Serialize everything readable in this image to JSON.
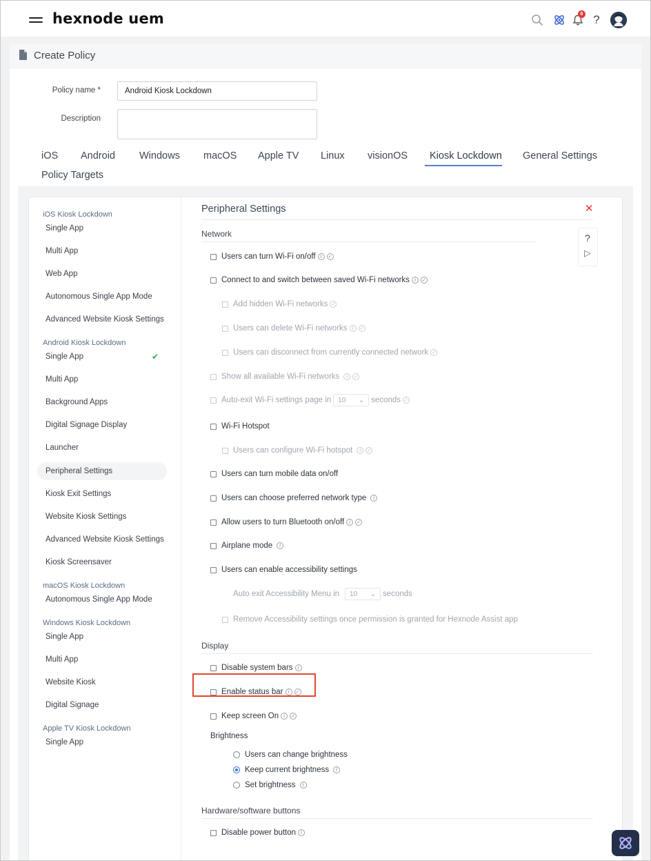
{
  "header": {
    "logo": "hexnode uem",
    "notification_count": "6",
    "help_label": "?"
  },
  "page": {
    "title": "Create Policy"
  },
  "form": {
    "policy_name_label": "Policy name *",
    "policy_name_value": "Android Kiosk Lockdown",
    "description_label": "Description",
    "description_value": ""
  },
  "tabs": [
    {
      "label": "iOS"
    },
    {
      "label": "Android"
    },
    {
      "label": "Windows"
    },
    {
      "label": "macOS"
    },
    {
      "label": "Apple TV"
    },
    {
      "label": "Linux"
    },
    {
      "label": "visionOS"
    },
    {
      "label": "Kiosk Lockdown",
      "active": true
    },
    {
      "label": "General Settings"
    },
    {
      "label": "Policy Targets"
    }
  ],
  "sidebar": {
    "groups": [
      {
        "title": "iOS Kiosk Lockdown",
        "items": [
          "Single App",
          "Multi App",
          "Web App",
          "Autonomous Single App Mode",
          "Advanced Website Kiosk Settings"
        ]
      },
      {
        "title": "Android Kiosk Lockdown",
        "items": [
          "Single App",
          "Multi App",
          "Background Apps",
          "Digital Signage Display",
          "Launcher",
          "Peripheral Settings",
          "Kiosk Exit Settings",
          "Website Kiosk Settings",
          "Advanced Website Kiosk Settings",
          "Kiosk Screensaver"
        ]
      },
      {
        "title": "macOS Kiosk Lockdown",
        "items": [
          "Autonomous Single App Mode"
        ]
      },
      {
        "title": "Windows Kiosk Lockdown",
        "items": [
          "Single App",
          "Multi App",
          "Website Kiosk",
          "Digital Signage"
        ]
      },
      {
        "title": "Apple TV Kiosk Lockdown",
        "items": [
          "Single App"
        ]
      }
    ],
    "selected": "Peripheral Settings",
    "configured": "Single App"
  },
  "section": {
    "title": "Peripheral Settings",
    "close_label": "✕",
    "help_label": "?",
    "play_label": "▷"
  },
  "network": {
    "heading": "Network",
    "options": {
      "wifi_onoff": "Users can turn Wi-Fi on/off",
      "switch_saved": "Connect to and switch between saved Wi-Fi networks",
      "add_hidden": "Add hidden Wi-Fi networks",
      "delete_wifi": "Users can delete Wi-Fi networks",
      "disconnect": "Users can disconnect from currently connected network",
      "show_all": "Show all available Wi-Fi networks",
      "auto_exit_prefix": "Auto-exit Wi-Fi settings page in",
      "auto_exit_value": "10",
      "auto_exit_suffix": "seconds",
      "hotspot": "Wi-Fi Hotspot",
      "config_hotspot": "Users can configure Wi-Fi hotspot",
      "mobile_data": "Users can turn mobile data on/off",
      "network_type": "Users can choose preferred network type",
      "bluetooth": "Allow users to turn Bluetooth on/off",
      "airplane": "Airplane mode",
      "accessibility": "Users can enable accessibility settings",
      "acc_exit_prefix": "Auto exit Accessibility Menu in",
      "acc_exit_value": "10",
      "acc_exit_suffix": "seconds",
      "remove_acc": "Remove Accessibility settings once permission is granted for Hexnode Assist app"
    }
  },
  "display": {
    "heading": "Display",
    "disable_bars": "Disable system bars",
    "status_bar": "Enable status bar",
    "keep_screen": "Keep screen On",
    "brightness_label": "Brightness",
    "brightness_options": [
      "Users can change brightness",
      "Keep current brightness",
      "Set brightness"
    ],
    "brightness_selected": "Keep current brightness"
  },
  "hardware": {
    "heading": "Hardware/software buttons",
    "power_button": "Disable power button"
  },
  "colors": {
    "accent": "#5a7fbf",
    "highlight": "#e2462c",
    "check": "#3aa655",
    "close": "#e53935"
  }
}
